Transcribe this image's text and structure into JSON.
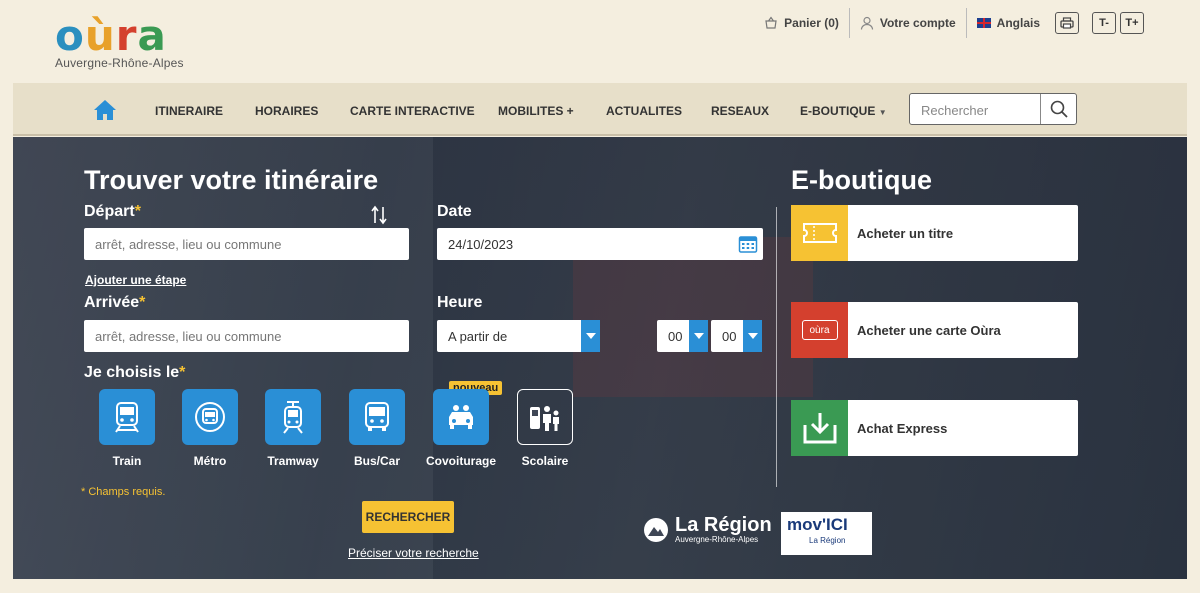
{
  "logo": {
    "word": "oùra",
    "sub": "Auvergne-Rhône-Alpes"
  },
  "utils": {
    "cart": "Panier (0)",
    "account": "Votre compte",
    "language": "Anglais",
    "text_smaller": "T-",
    "text_bigger": "T+"
  },
  "nav": {
    "items": [
      "ITINERAIRE",
      "HORAIRES",
      "CARTE INTERACTIVE",
      "MOBILITES +",
      "ACTUALITES",
      "RESEAUX",
      "E-BOUTIQUE"
    ],
    "search_placeholder": "Rechercher"
  },
  "planner": {
    "title": "Trouver votre itinéraire",
    "depart_label": "Départ",
    "depart_placeholder": "arrêt, adresse, lieu ou commune",
    "add_step": "Ajouter une étape",
    "arrivee_label": "Arrivée",
    "arrivee_placeholder": "arrêt, adresse, lieu ou commune",
    "date_label": "Date",
    "date_value": "24/10/2023",
    "heure_label": "Heure",
    "heure_mode": "A partir de",
    "hour": "00",
    "minute": "00",
    "mode_label": "Je choisis le",
    "modes": [
      "Train",
      "Métro",
      "Tramway",
      "Bus/Car",
      "Covoiturage",
      "Scolaire"
    ],
    "new_badge": "nouveau",
    "required": "* Champs requis.",
    "search_button": "RECHERCHER",
    "refine_link": "Préciser votre recherche"
  },
  "eshop": {
    "title": "E-boutique",
    "cards": [
      "Acheter un titre",
      "Acheter une carte Oùra",
      "Achat Express"
    ],
    "oura_card_text": "oùra"
  },
  "partners": {
    "region_title": "La Région",
    "region_sub": "Auvergne-Rhône-Alpes",
    "movici": "mov'ICI",
    "movici_sub": "La Région"
  },
  "colors": {
    "accent": "#2a8fd6",
    "yellow": "#f6c233",
    "red": "#d4402e",
    "green": "#3a9a53"
  }
}
